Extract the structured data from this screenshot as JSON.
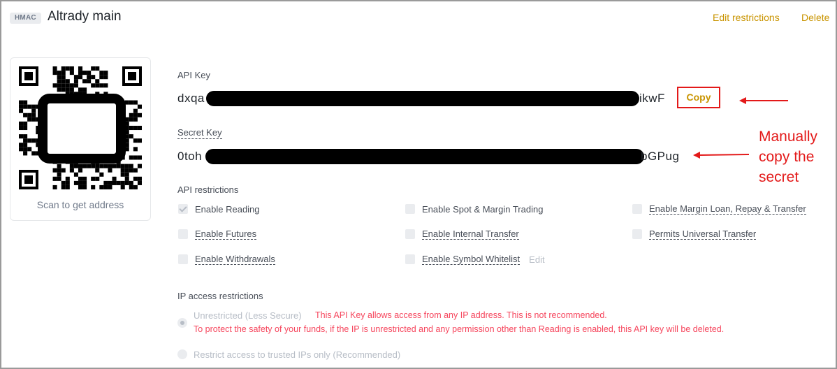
{
  "header": {
    "badge": "HMAC",
    "key_name": "Altrady main",
    "edit_restrictions": "Edit restrictions",
    "delete": "Delete"
  },
  "qr": {
    "caption": "Scan to get address",
    "icon": "qr-code-icon"
  },
  "api_key": {
    "label": "API Key",
    "visible_start": "dxqa",
    "visible_end": "ikwF",
    "copy_label": "Copy"
  },
  "secret_key": {
    "label": "Secret Key",
    "visible_start": "0toh",
    "visible_end": "bGPug"
  },
  "annotation": {
    "text_lines": [
      "Manually",
      "copy the",
      "secret"
    ],
    "color": "#e31919"
  },
  "api_restrictions": {
    "title": "API restrictions",
    "permissions": [
      {
        "label": "Enable Reading",
        "checked": true
      },
      {
        "label": "Enable Spot & Margin Trading",
        "checked": false
      },
      {
        "label": "Enable Margin Loan, Repay & Transfer",
        "checked": false
      },
      {
        "label": "Enable Futures",
        "checked": false
      },
      {
        "label": "Enable Internal Transfer",
        "checked": false
      },
      {
        "label": "Permits Universal Transfer",
        "checked": false
      },
      {
        "label": "Enable Withdrawals",
        "checked": false
      },
      {
        "label": "Enable Symbol Whitelist",
        "checked": false
      }
    ],
    "whitelist_edit": "Edit"
  },
  "ip_restrictions": {
    "title": "IP access restrictions",
    "unrestricted_label": "Unrestricted (Less Secure)",
    "unrestricted_warning_1": "This API Key allows access from any IP address. This is not recommended.",
    "unrestricted_warning_2": "To protect the safety of your funds, if the IP is unrestricted and any permission other than Reading is enabled, this API key will be deleted.",
    "restricted_label": "Restrict access to trusted IPs only (Recommended)",
    "selected": "unrestricted"
  },
  "colors": {
    "accent": "#c99400",
    "warning": "#f6465d",
    "annotation_red": "#e31919"
  }
}
